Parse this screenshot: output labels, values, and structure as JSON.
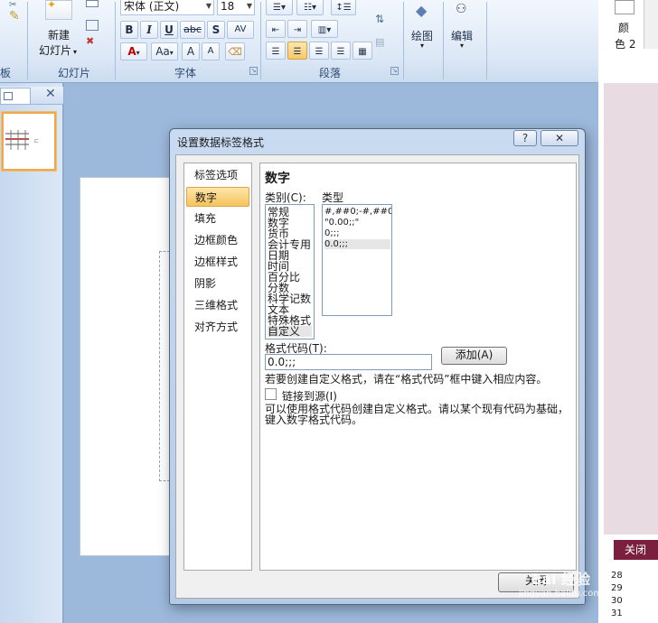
{
  "ribbon": {
    "slides_group": {
      "new_slide_label_1": "新建",
      "new_slide_label_2": "幻灯片",
      "group_label": "幻灯片"
    },
    "clipboard_group": {
      "group_label_partial": "板"
    },
    "font_group": {
      "font_name": "宋体 (正文)",
      "font_size": "18",
      "bold": "B",
      "italic": "I",
      "underline": "U",
      "strikethrough": "abc",
      "shadow": "S",
      "char_spacing": "AV",
      "font_color": "A",
      "change_case": "Aa",
      "grow_font": "A",
      "shrink_font": "A",
      "group_label": "字体"
    },
    "paragraph_group": {
      "group_label": "段落"
    },
    "drawing_group": {
      "label": "绘图"
    },
    "editing_group": {
      "label": "编辑"
    }
  },
  "right_app": {
    "color_label_1": "颜",
    "color_label_2": "色 2",
    "close_button": "关闭(C",
    "row_numbers": [
      "28",
      "29",
      "30",
      "31"
    ]
  },
  "dialog": {
    "title": "设置数据标签格式",
    "help_button": "?",
    "close_icon_label": "✕",
    "nav_items": [
      "标签选项",
      "数字",
      "填充",
      "边框颜色",
      "边框样式",
      "阴影",
      "三维格式",
      "对齐方式"
    ],
    "selected_nav": "数字",
    "section_title": "数字",
    "category_label": "类别(C):",
    "type_label": "类型",
    "categories": [
      "常规",
      "数字",
      "货币",
      "会计专用",
      "日期",
      "时间",
      "百分比",
      "分数",
      "科学记数",
      "文本",
      "特殊格式",
      "自定义"
    ],
    "selected_category": "自定义",
    "types": [
      "#,##0;-#,##0",
      "\"0.00;;\"",
      "0;;;",
      "0.0;;;"
    ],
    "selected_type": "0.0;;;",
    "format_code_label": "格式代码(T):",
    "format_code_value": "0.0;;;",
    "add_button": "添加(A)",
    "hint_text": "若要创建自定义格式，请在“格式代码”框中键入相应内容。",
    "link_to_source_label": "链接到源(I)",
    "link_to_source_checked": false,
    "description_line_1": "可以使用格式代码创建自定义格式。请以某个现有代码为基础，",
    "description_line_2": "键入数字格式代码。",
    "close_button": "关闭"
  },
  "watermark": {
    "line1": "Bai 经验",
    "line2": "jingyan.baidu.com"
  },
  "colors": {
    "ribbon_bg": "#dce8f6",
    "selected_orange": "#f6c35d",
    "app_close_bg": "#7a1f3e"
  }
}
